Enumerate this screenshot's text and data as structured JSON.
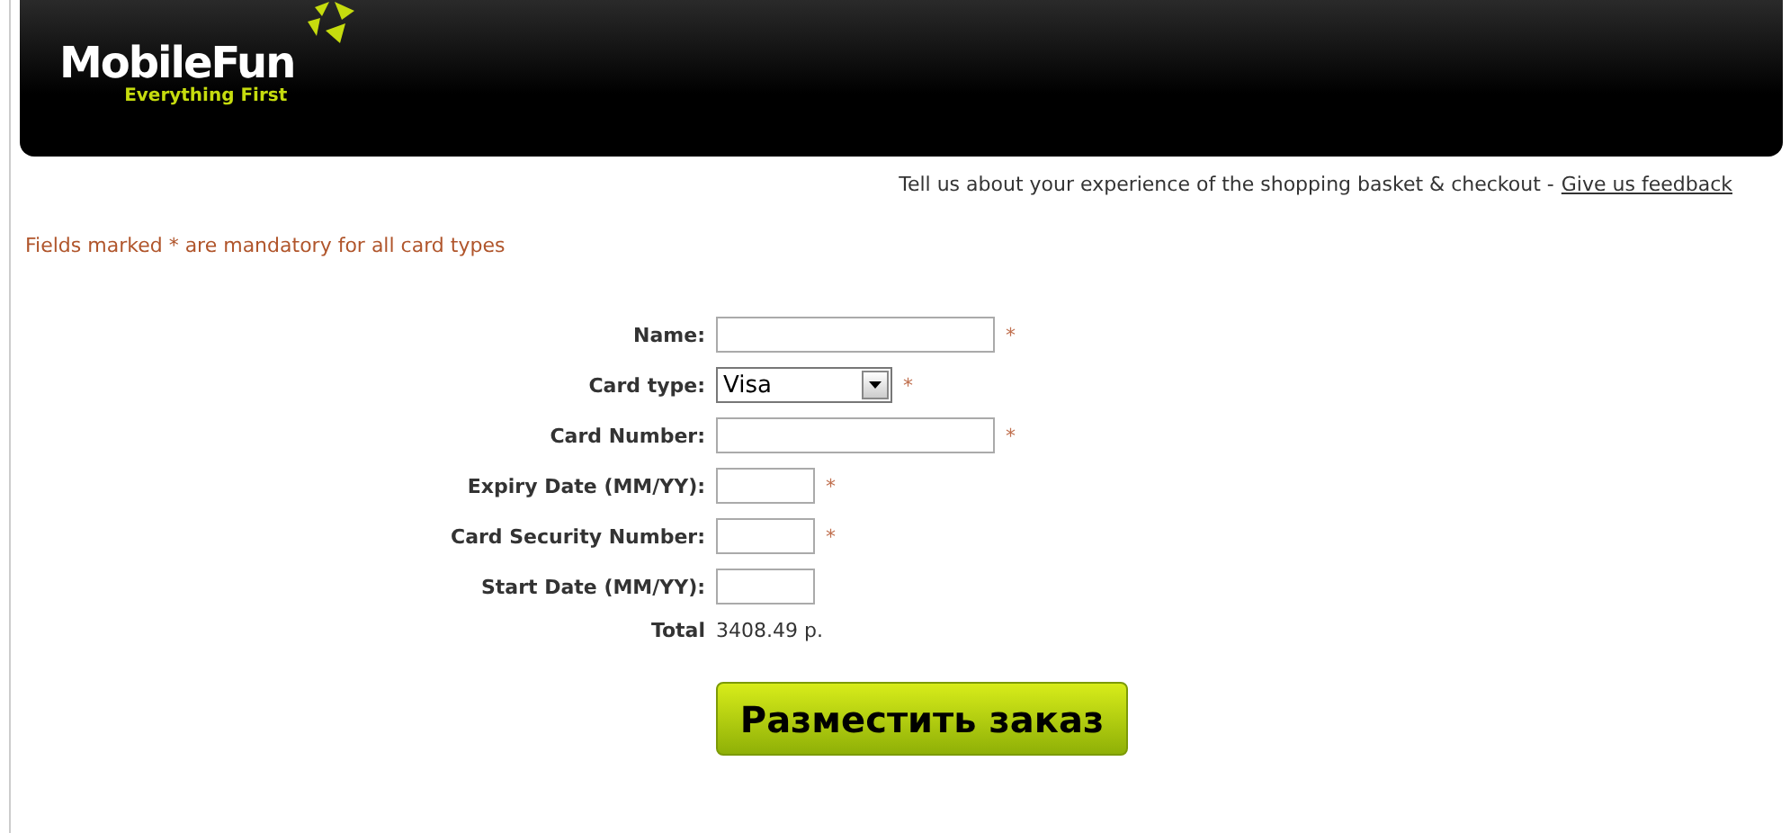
{
  "header": {
    "logo": "MobileFun",
    "tagline": "Everything First"
  },
  "feedback": {
    "text": "Tell us about your experience of the shopping basket & checkout - ",
    "link": "Give us feedback"
  },
  "notice": "Fields marked * are mandatory for all card types",
  "fields": [
    {
      "label": "Name:",
      "kind": "long",
      "marker": "*"
    },
    {
      "label": "Card type:",
      "kind": "select",
      "value": "Visa",
      "marker": "*"
    },
    {
      "label": "Card Number:",
      "kind": "long",
      "marker": "*"
    },
    {
      "label": "Expiry Date (MM/YY):",
      "kind": "short",
      "marker": "*"
    },
    {
      "label": "Card Security Number:",
      "kind": "short",
      "marker": "*"
    },
    {
      "label": "Start Date (MM/YY):",
      "kind": "short"
    }
  ],
  "total": {
    "label": "Total",
    "value": "3408.49 р."
  },
  "submit": "Разместить заказ"
}
